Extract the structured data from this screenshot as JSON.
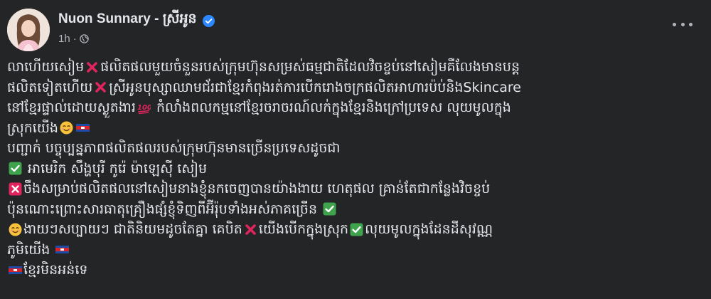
{
  "post": {
    "author": "Nuon Sunnary - ស្រីអូន",
    "time": "1h",
    "audience_icon": "globe-icon",
    "menu_icon": "more-options-icon"
  },
  "body": {
    "line1a": "លាហើយសៀម",
    "line1b": "ផលិតផលមួយចំនួនរបស់ក្រុមហ៊ុនសម្រស់ធម្មជាតិដែលវិចខ្ចប់នៅសៀមគឺលែងមានបន្ត",
    "line2a": "ផលិតទៀតហើយ",
    "line2b": "ស្រីអូនបុស្សាឈាមជ័រជាខ្មែរកំពុងរត់ការបើករោងចក្រផលិតអាហារប៉ប់និងSkincare",
    "line3a": "នៅខ្មែរផ្ទាល់ដោយស្ងួតងារ",
    "line3b": " កំលាំងពលកម្មនៅខ្មែរចរាចរណ៍លក់ក្នុងខ្មែរនិងក្រៅប្រទេស លុយមូលក្នុង",
    "line4a": "ស្រុកយើង",
    "line5": "បញ្ជាក់ បច្ចុប្បន្នភាពផលិតផលរបស់ក្រុមហ៊ុនមានច្រើនប្រទេសដូចជា",
    "line6": " អាមេរិក សឹង្ហបុរី កូរ៉េ ម៉ាឡេស៊ី សៀម",
    "line7": "ចឹងសម្រាប់ផលិតផលនៅសៀមនាងខ្ញុំនកចេញបានយ៉ាងងាយ ហេតុផល គ្រាន់តែជាកន្លែងវិចខ្ចប់",
    "line8": "ប៉ុនណោះព្រោះសារធាតុគ្រឿងផ្សំខ្ញុំទិញពីអ៊ីរ៉ុបទាំងអស់ភាគច្រើន ",
    "line9a": "ងាយៗសប្បាយៗ ជាតិនិយមដូចតែគ្នា គេបិត",
    "line9b": "យើងបើកក្នុងស្រុក",
    "line9c": "លុយមូលក្នុងដែនដីសុវណ្ណ",
    "line10": "ភូមិយើង ",
    "line11": "ខ្មែរមិនអន់ទេ"
  },
  "colors": {
    "background": "#242526",
    "text": "#e4e6eb",
    "secondary": "#b0b3b8",
    "verified": "#2d88ff",
    "cross": "#e0245e",
    "check": "#3fa34d"
  }
}
